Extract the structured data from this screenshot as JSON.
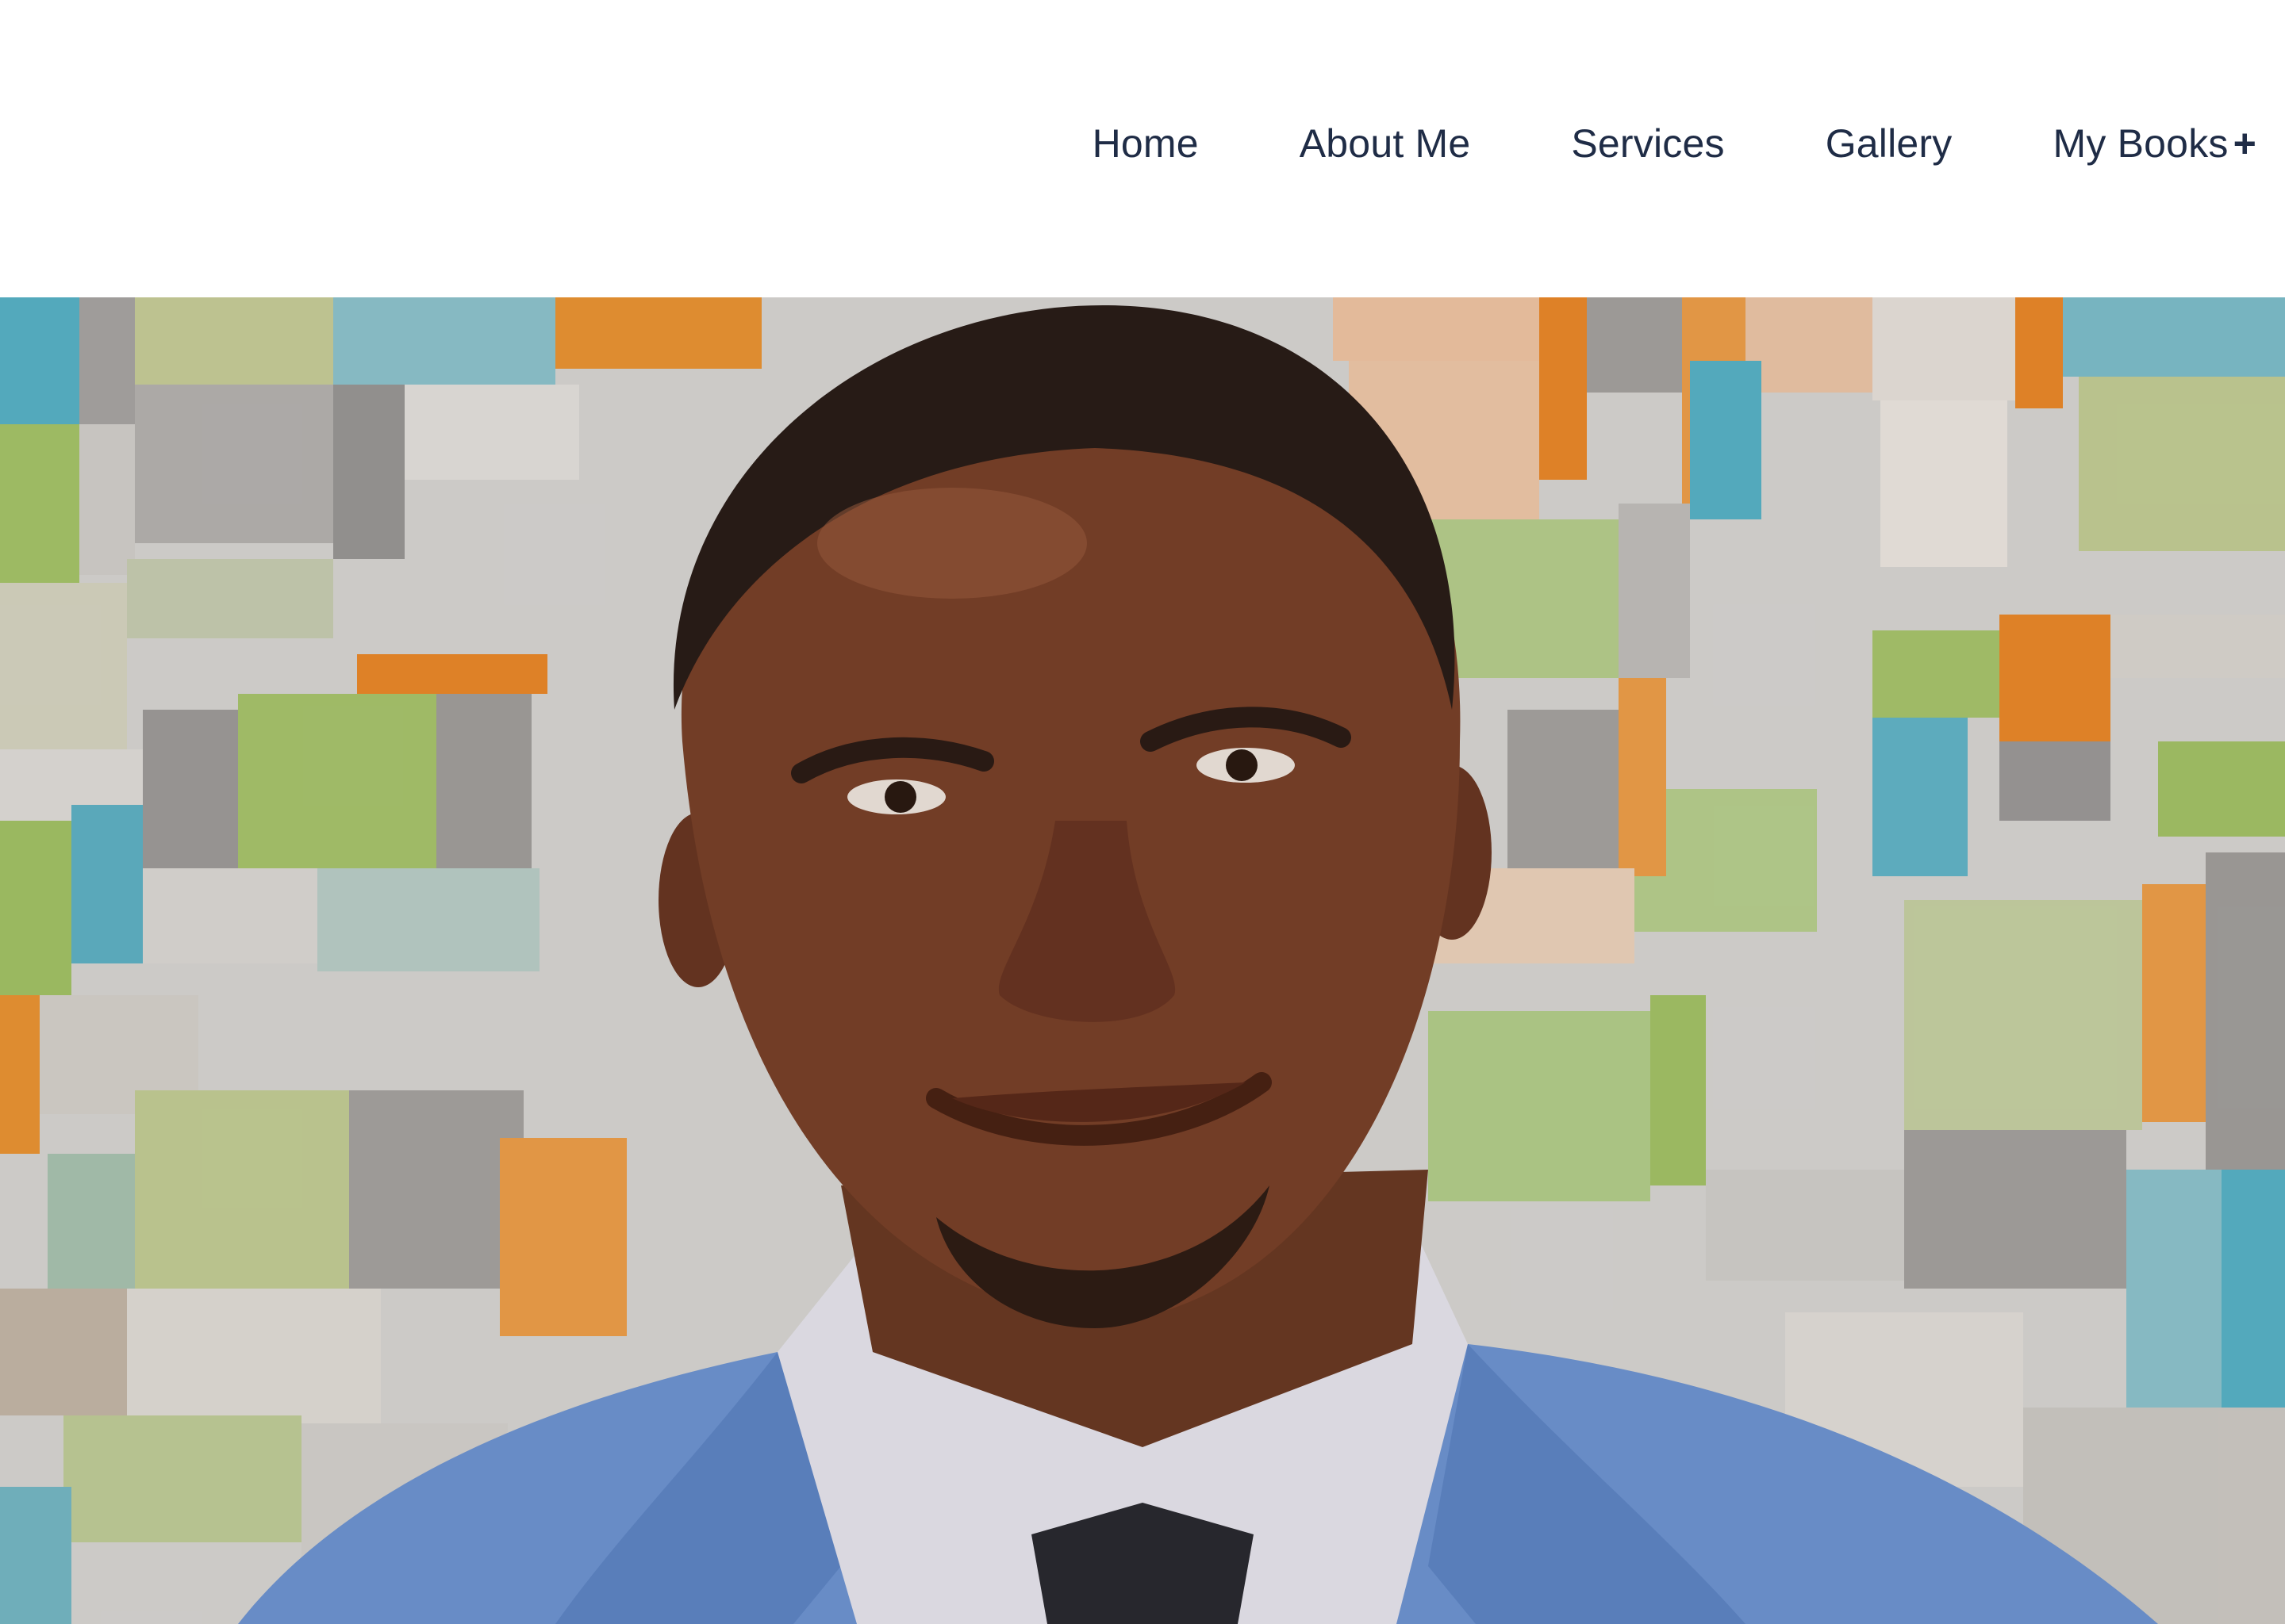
{
  "nav": {
    "items": [
      {
        "label": "Home"
      },
      {
        "label": "About Me"
      },
      {
        "label": "Services"
      },
      {
        "label": "Gallery"
      },
      {
        "label": "My Books"
      }
    ],
    "submenu_indicator": "+"
  },
  "colors": {
    "nav_text": "#1f2c46",
    "header_background": "#ffffff"
  },
  "hero": {
    "image": "portrait of a smiling man in a light blue suit jacket, white shirt and dark tie, in front of a colorful geometric cube-pattern wall"
  }
}
